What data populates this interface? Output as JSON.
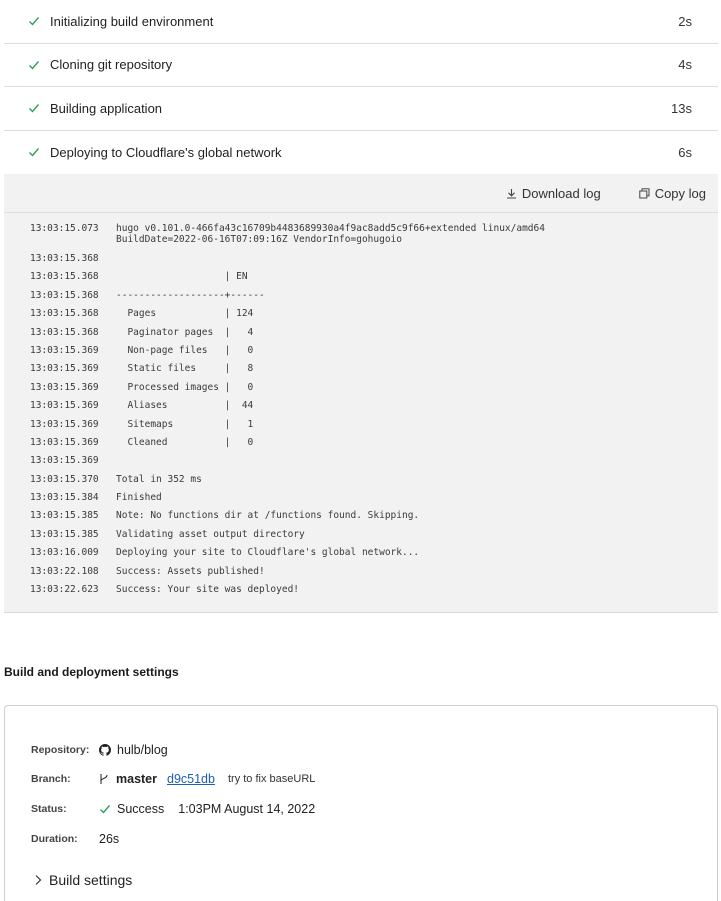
{
  "steps": [
    {
      "label": "Initializing build environment",
      "duration": "2s"
    },
    {
      "label": "Cloning git repository",
      "duration": "4s"
    },
    {
      "label": "Building application",
      "duration": "13s"
    },
    {
      "label": "Deploying to Cloudflare's global network",
      "duration": "6s"
    }
  ],
  "log": {
    "download_label": "Download log",
    "copy_label": "Copy log",
    "lines": [
      {
        "ts": "13:03:15.073",
        "msg": "hugo v0.101.0-466fa43c16709b4483689930a4f9ac8add5c9f66+extended linux/amd64\nBuildDate=2022-06-16T07:09:16Z VendorInfo=gohugoio"
      },
      {
        "ts": "13:03:15.368",
        "msg": ""
      },
      {
        "ts": "13:03:15.368",
        "msg": "                   | EN"
      },
      {
        "ts": "13:03:15.368",
        "msg": "-------------------+------"
      },
      {
        "ts": "13:03:15.368",
        "msg": "  Pages            | 124"
      },
      {
        "ts": "13:03:15.368",
        "msg": "  Paginator pages  |   4"
      },
      {
        "ts": "13:03:15.369",
        "msg": "  Non-page files   |   0"
      },
      {
        "ts": "13:03:15.369",
        "msg": "  Static files     |   8"
      },
      {
        "ts": "13:03:15.369",
        "msg": "  Processed images |   0"
      },
      {
        "ts": "13:03:15.369",
        "msg": "  Aliases          |  44"
      },
      {
        "ts": "13:03:15.369",
        "msg": "  Sitemaps         |   1"
      },
      {
        "ts": "13:03:15.369",
        "msg": "  Cleaned          |   0"
      },
      {
        "ts": "13:03:15.369",
        "msg": ""
      },
      {
        "ts": "13:03:15.370",
        "msg": "Total in 352 ms"
      },
      {
        "ts": "13:03:15.384",
        "msg": "Finished"
      },
      {
        "ts": "13:03:15.385",
        "msg": "Note: No functions dir at /functions found. Skipping."
      },
      {
        "ts": "13:03:15.385",
        "msg": "Validating asset output directory"
      },
      {
        "ts": "13:03:16.009",
        "msg": "Deploying your site to Cloudflare's global network..."
      },
      {
        "ts": "13:03:22.108",
        "msg": "Success: Assets published!"
      },
      {
        "ts": "13:03:22.623",
        "msg": "Success: Your site was deployed!"
      }
    ]
  },
  "settings": {
    "title": "Build and deployment settings",
    "repository_key": "Repository:",
    "repository_value": "hulb/blog",
    "branch_key": "Branch:",
    "branch_name": "master",
    "commit_hash": "d9c51db",
    "commit_message": "try to fix baseURL",
    "status_key": "Status:",
    "status_value": "Success",
    "status_date": "1:03PM August 14, 2022",
    "duration_key": "Duration:",
    "duration_value": "26s",
    "build_settings_label": "Build settings"
  },
  "colors": {
    "success": "#2e9e5b",
    "link": "#1a5fb4"
  }
}
